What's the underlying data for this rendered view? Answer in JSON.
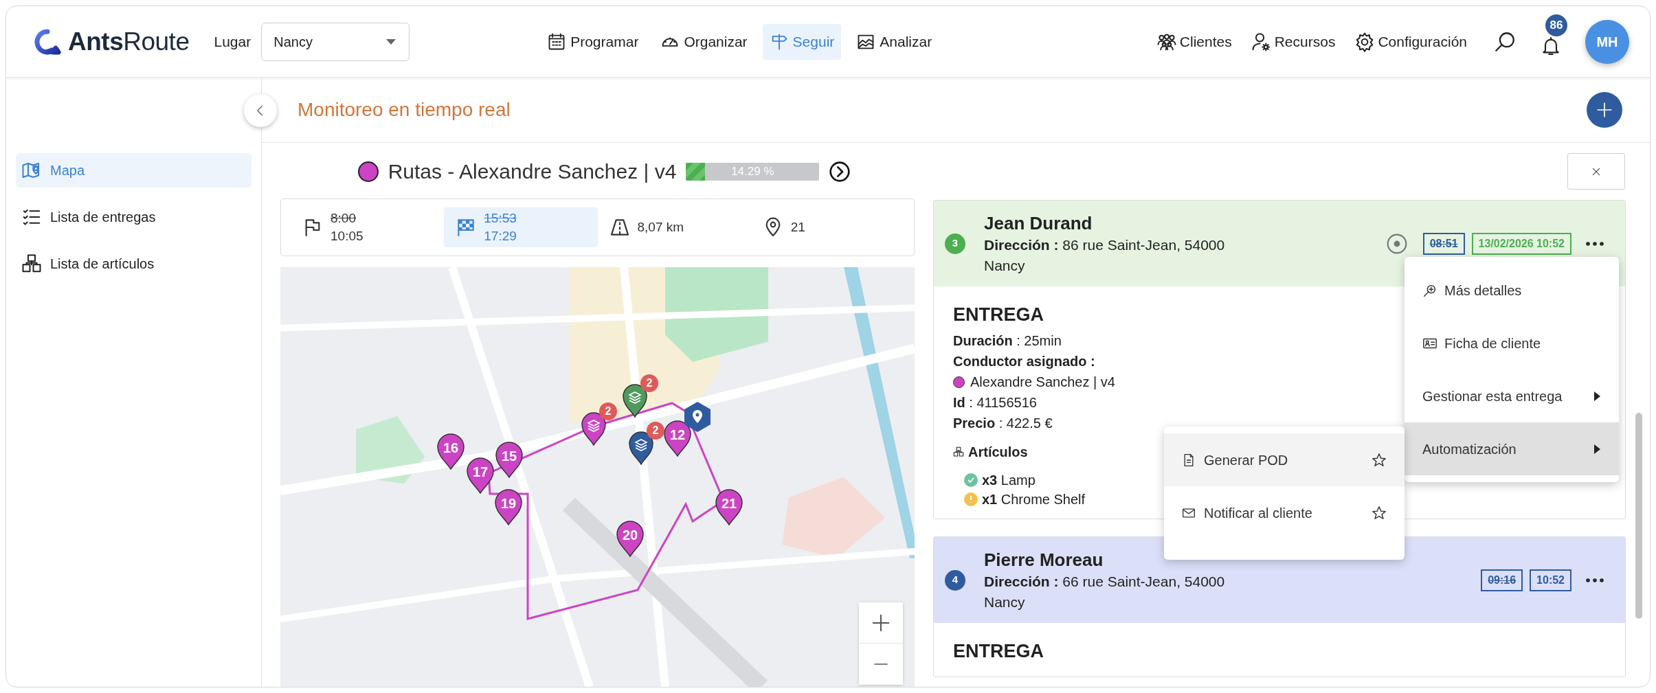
{
  "header": {
    "logo": "**Ants**Route",
    "place_label": "Lugar",
    "place_value": "Nancy",
    "nav": [
      {
        "label": "Programar",
        "selected": false
      },
      {
        "label": "Organizar",
        "selected": false
      },
      {
        "label": "Seguir",
        "selected": true
      },
      {
        "label": "Analizar",
        "selected": false
      }
    ],
    "right_nav": [
      {
        "label": "Clientes"
      },
      {
        "label": "Recursos"
      },
      {
        "label": "Configuración"
      }
    ],
    "notifications": "86",
    "avatar": "MH"
  },
  "sidebar": {
    "items": [
      {
        "label": "Mapa",
        "selected": true
      },
      {
        "label": "Lista de entregas",
        "selected": false
      },
      {
        "label": "Lista de artículos",
        "selected": false
      }
    ]
  },
  "page_title": "Monitoreo en tiempo real",
  "route": {
    "name": "Rutas - Alexandre Sanchez | v4",
    "color": "#cc44c4",
    "progress": {
      "level": 0.1429,
      "label": "14.29 %"
    }
  },
  "stats": [
    {
      "kind": "start",
      "old": "8:00",
      "value": "10:05",
      "selected": false
    },
    {
      "kind": "finish",
      "old": "15:53",
      "value": "17:29",
      "selected": true
    },
    {
      "kind": "distance",
      "value": "8,07 km",
      "selected": false
    },
    {
      "kind": "stops",
      "value": "21",
      "selected": false
    }
  ],
  "map": {
    "markers": [
      {
        "kind": "stop",
        "label": "16"
      },
      {
        "kind": "stop",
        "label": "17"
      },
      {
        "kind": "stop",
        "label": "15"
      },
      {
        "kind": "stop",
        "label": "19"
      },
      {
        "kind": "stop",
        "label": "20"
      },
      {
        "kind": "stop",
        "label": "21"
      },
      {
        "kind": "stop",
        "label": "12"
      },
      {
        "kind": "cluster",
        "count": "2",
        "color": "#4f9a5c"
      },
      {
        "kind": "cluster",
        "count": "2",
        "color": "#cc44c4"
      },
      {
        "kind": "cluster",
        "count": "2",
        "color": "#2f5c9e"
      },
      {
        "kind": "depot",
        "color": "#2f5c9e"
      }
    ]
  },
  "deliveries": [
    {
      "kind": "done",
      "number": "3",
      "name": "Jean Durand",
      "address": "**Dirección :** 86 rue Saint-Jean, 54000",
      "city": "Nancy",
      "locate": true,
      "planned": "08:51",
      "actual": "13/02/2026 10:52",
      "section": "ENTREGA",
      "duration": "**Duración** : 25min",
      "driver_label": "Conductor asignado :",
      "driver": {
        "name": "Alexandre Sanchez | v4",
        "color": "#cc44c4"
      },
      "id": "**Id** : 41156516",
      "price": "**Precio** : 422.5 €",
      "articles_title": "Artículos",
      "articles": [
        {
          "kind": "ok",
          "text": "**x3** Lamp"
        },
        {
          "kind": "warning",
          "text": "**x1** Chrome Shelf"
        }
      ]
    },
    {
      "kind": "planned",
      "number": "4",
      "name": "Pierre Moreau",
      "address": "**Dirección :** 66 rue Saint-Jean, 54000",
      "city": "Nancy",
      "locate": false,
      "planned": "09:16",
      "actual": "10:52",
      "section": "ENTREGA"
    }
  ],
  "menu": {
    "items": [
      {
        "label": "Más detalles",
        "submenu": false,
        "selected": false
      },
      {
        "label": "Ficha de cliente",
        "submenu": false,
        "selected": false
      },
      {
        "label": "Gestionar esta entrega",
        "submenu": true,
        "selected": false
      },
      {
        "label": "Automatización",
        "submenu": true,
        "selected": true
      }
    ]
  },
  "submenu": {
    "items": [
      {
        "label": "Generar POD",
        "starred": false,
        "selected": true
      },
      {
        "label": "Notificar al cliente",
        "starred": false,
        "selected": false
      }
    ]
  }
}
